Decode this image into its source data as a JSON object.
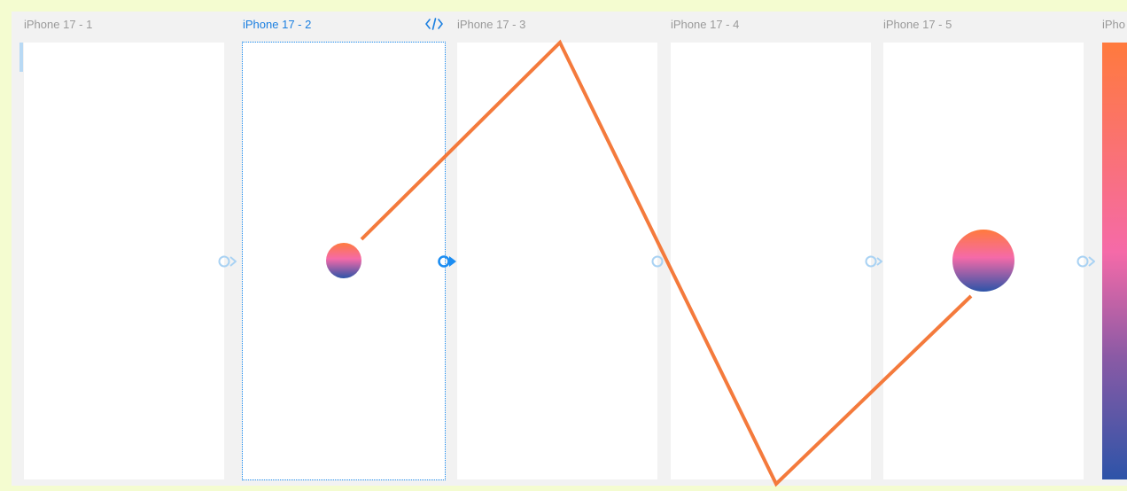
{
  "canvas": {
    "frames": [
      {
        "label": "iPhone 17 - 1",
        "selected": false
      },
      {
        "label": "iPhone 17 - 2",
        "selected": true
      },
      {
        "label": "iPhone 17 - 3",
        "selected": false
      },
      {
        "label": "iPhone 17 - 4",
        "selected": false
      },
      {
        "label": "iPhone 17 - 5",
        "selected": false
      },
      {
        "label": "iPho",
        "selected": false
      }
    ],
    "colors": {
      "background": "#f4fcd0",
      "workspace": "#f2f2f2",
      "selection": "#1b8df2",
      "label": "#9a9a9a",
      "active_label": "#1b7fe0",
      "path": "#f47a3c",
      "gradient_top": "#ff7a3d",
      "gradient_mid": "#f56aa8",
      "gradient_bottom": "#2d54a8"
    },
    "icons": {
      "code": "code-icon",
      "connector": "prototype-connector-icon"
    }
  }
}
